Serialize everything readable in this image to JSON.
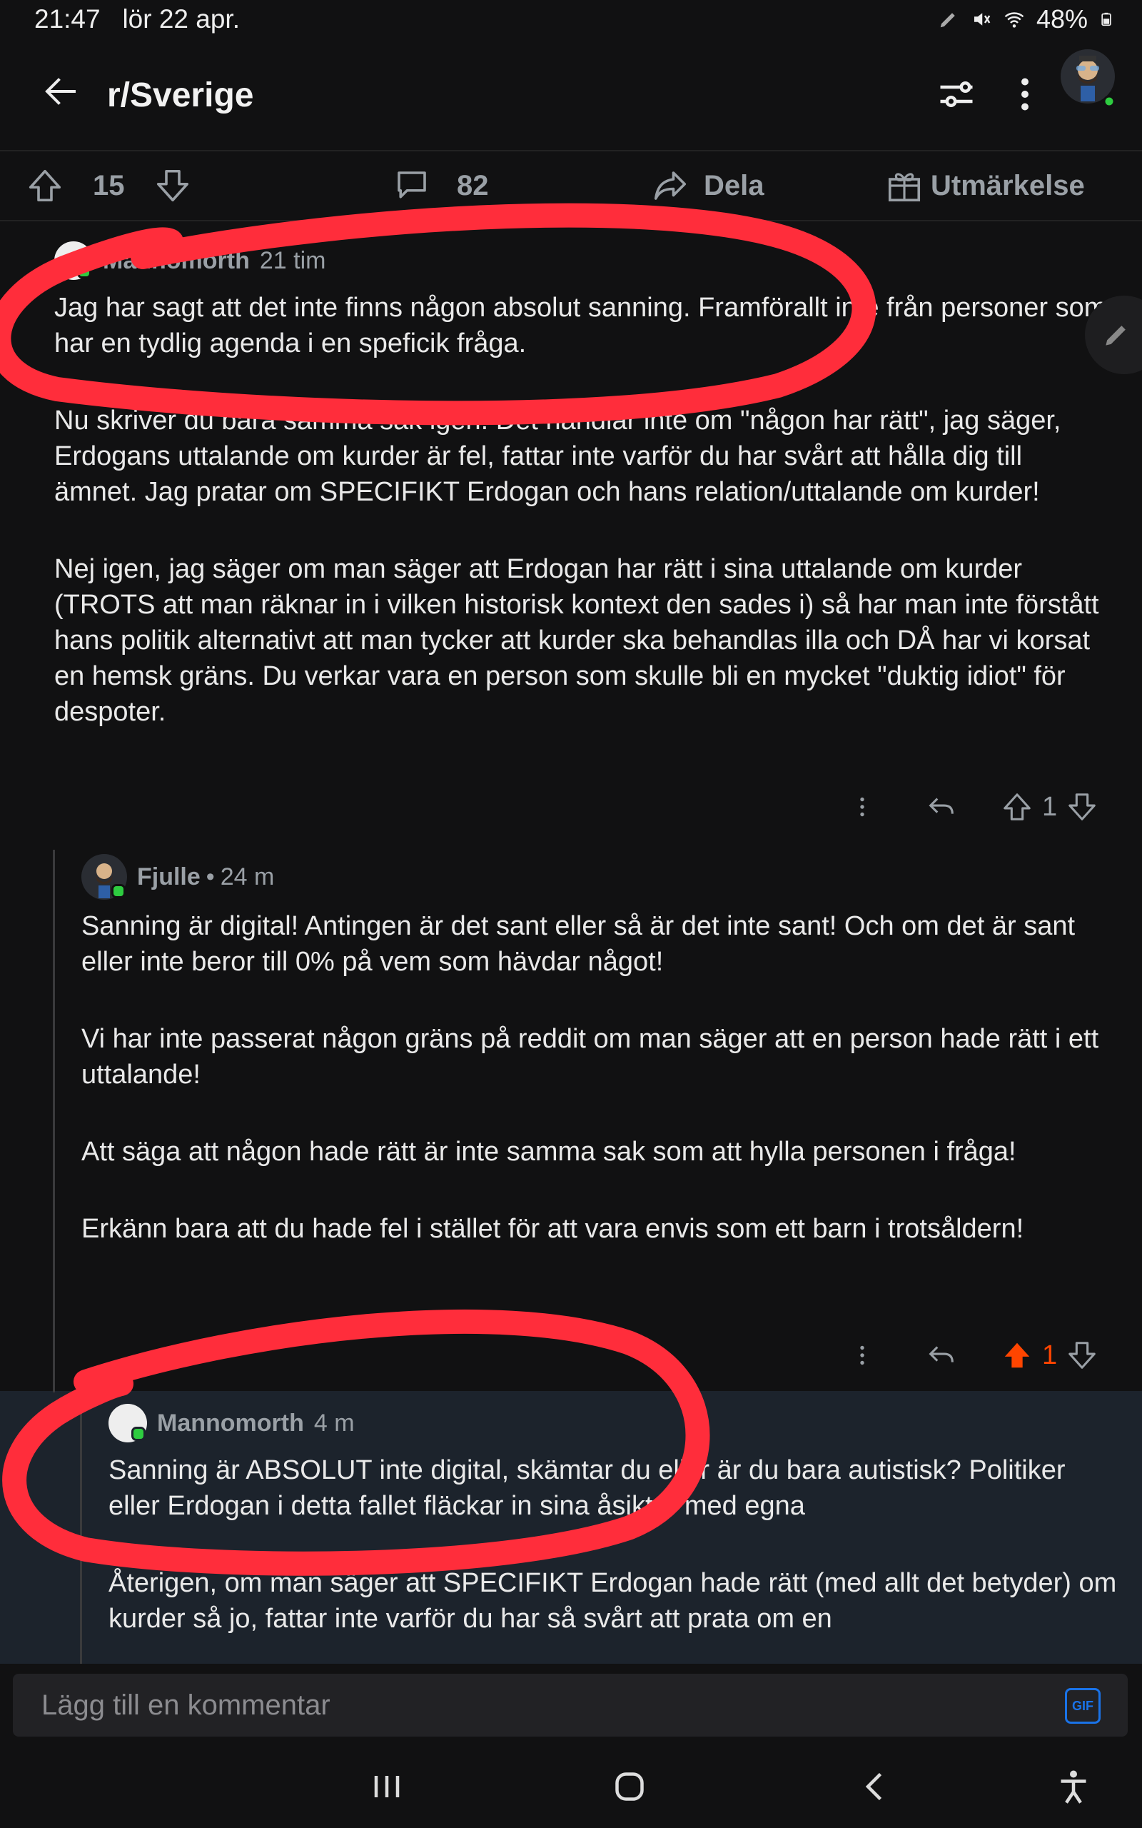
{
  "status_bar": {
    "time": "21:47",
    "date": "lör 22 apr.",
    "battery": "48%"
  },
  "header": {
    "title": "r/Sverige"
  },
  "post_actions": {
    "score": "15",
    "comments": "82",
    "share_label": "Dela",
    "award_label": "Utmärkelse"
  },
  "comments": [
    {
      "user": "Mannomorth",
      "age": "21 tim",
      "paragraphs": [
        "Jag har sagt att det inte finns någon absolut sanning. Framförallt inte från personer som har en tydlig agenda i en speficik fråga.",
        "Nu skriver du bara samma sak igen. Det handlar inte om \"någon har rätt\", jag säger, Erdogans uttalande om kurder är fel, fattar inte varför du har svårt att hålla dig till ämnet. Jag pratar om SPECIFIKT Erdogan och hans relation/uttalande om kurder!",
        "Nej igen, jag säger om man säger att Erdogan har rätt i sina uttalande om kurder (TROTS att man räknar in i vilken historisk kontext den sades i) så har man inte förstått hans politik alternativt att man tycker att kurder ska behandlas illa och DÅ har vi korsat en hemsk gräns. Du verkar vara en person som skulle bli en mycket  \"duktig idiot\" för despoter."
      ],
      "votes": "1"
    },
    {
      "user": "Fjulle",
      "separator": "•",
      "age": "24 m",
      "paragraphs": [
        "Sanning är digital! Antingen är det sant eller så är det inte sant! Och om det är sant eller inte beror till 0% på vem som hävdar något!",
        "Vi har inte passerat någon gräns på reddit om man säger att en person hade rätt i ett uttalande!",
        "Att säga att någon hade rätt är inte samma sak som att hylla personen i fråga!",
        "Erkänn bara att du hade fel i stället för att vara envis som ett barn i trotsåldern!"
      ],
      "votes": "1"
    },
    {
      "user": "Mannomorth",
      "age": "4 m",
      "paragraphs": [
        "Sanning är ABSOLUT inte digital, skämtar du eller är du bara autistisk? Politiker eller Erdogan i detta fallet fläckar in sina åsikter med egna",
        "Återigen, om man säger att SPECIFIKT Erdogan hade rätt (med allt det betyder) om kurder så jo, fattar inte varför du har så svårt att prata om en"
      ]
    }
  ],
  "composer": {
    "placeholder": "Lägg till en kommentar",
    "gif_label": "GIF"
  },
  "colors": {
    "background": "#111112",
    "upvote_active": "#ff4500",
    "online": "#2ecc40",
    "highlight_bg": "#1c232c",
    "annotation": "#ff2d3b"
  }
}
